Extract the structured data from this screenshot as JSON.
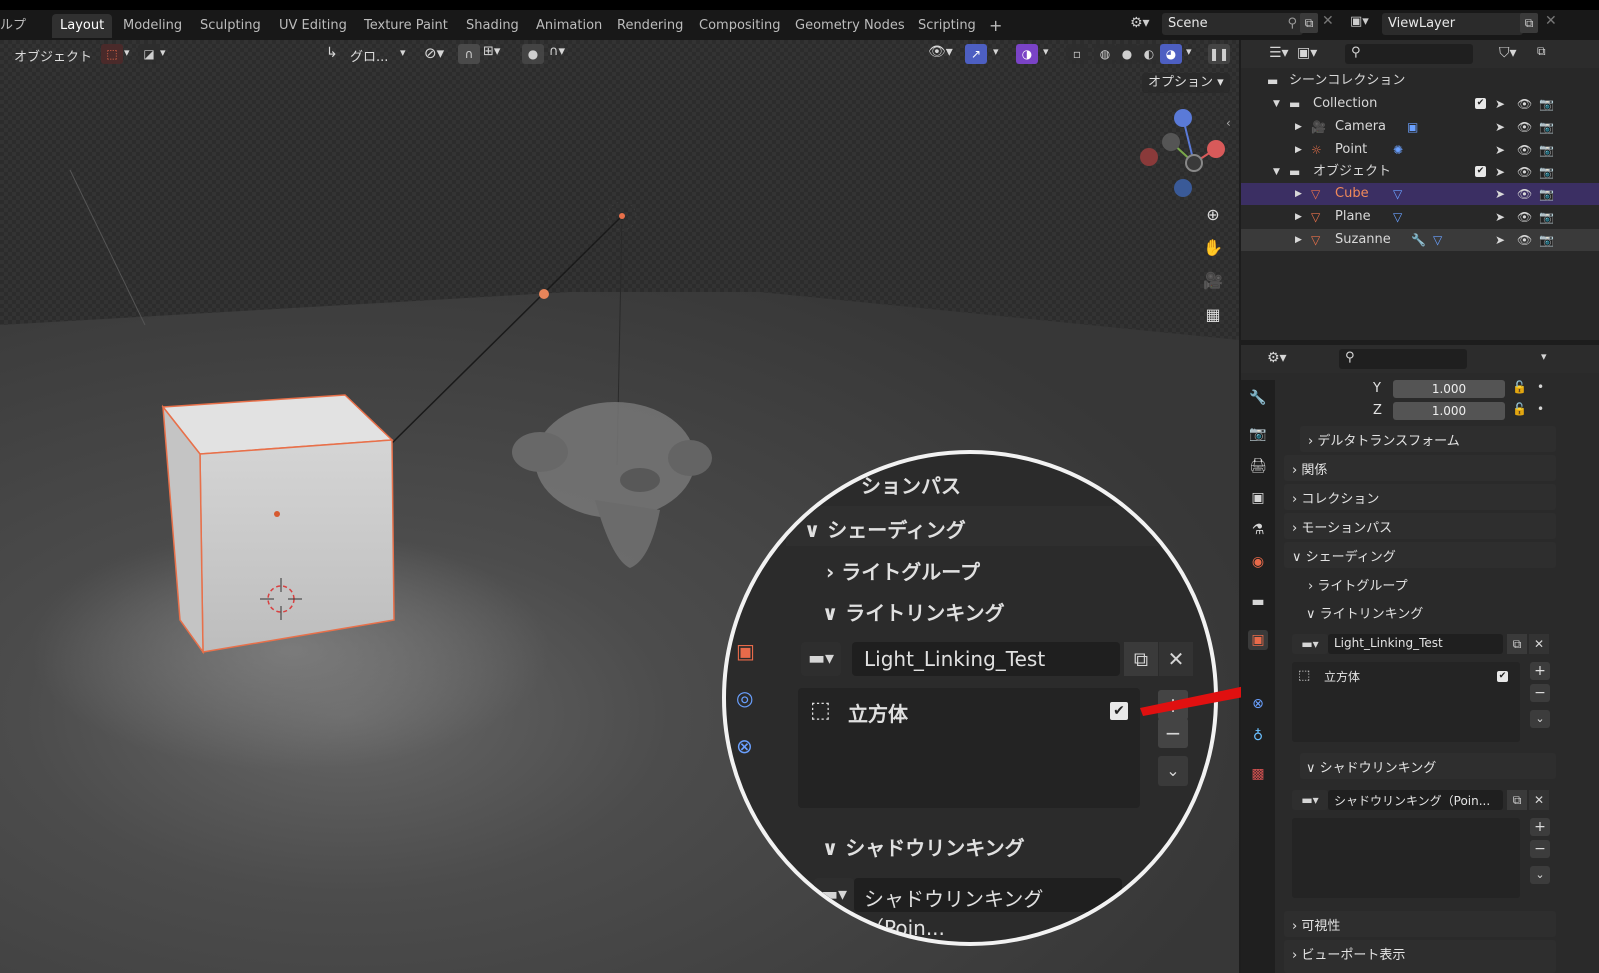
{
  "topbar": {
    "menu_fragment": "ルプ",
    "tabs": [
      "Layout",
      "Modeling",
      "Sculpting",
      "UV Editing",
      "Texture Paint",
      "Shading",
      "Animation",
      "Rendering",
      "Compositing",
      "Geometry Nodes",
      "Scripting"
    ],
    "add_tab": "+",
    "scene": "Scene",
    "view_layer": "ViewLayer"
  },
  "viewport": {
    "mode": "オブジェクト",
    "transform_orientation": "グロ...",
    "options": "オプション"
  },
  "outliner": {
    "scene_collection": "シーンコレクション",
    "rows": [
      {
        "name": "Collection",
        "level": 0
      },
      {
        "name": "Camera",
        "level": 1
      },
      {
        "name": "Point",
        "level": 1
      },
      {
        "name": "オブジェクト",
        "level": 0
      },
      {
        "name": "Cube",
        "level": 1
      },
      {
        "name": "Plane",
        "level": 1
      },
      {
        "name": "Suzanne",
        "level": 1
      }
    ]
  },
  "properties": {
    "scale_y_label": "Y",
    "scale_y": "1.000",
    "scale_z_label": "Z",
    "scale_z": "1.000",
    "delta_transform": "デルタトランスフォーム",
    "relations": "関係",
    "collections": "コレクション",
    "motion_paths": "モーションパス",
    "shading": "シェーディング",
    "light_group": "ライトグループ",
    "light_linking": "ライトリンキング",
    "light_linking_collection": "Light_Linking_Test",
    "light_linking_item": "立方体",
    "shadow_linking": "シャドウリンキング",
    "shadow_linking_collection": "シャドウリンキング（Poin...",
    "visibility": "可視性",
    "viewport_display": "ビューポート表示"
  },
  "magnifier": {
    "motion_paths_fragment": "ションパス",
    "shading": "シェーディング",
    "light_group": "ライトグループ",
    "light_linking": "ライトリンキング",
    "collection": "Light_Linking_Test",
    "item": "立方体",
    "shadow_linking": "シャドウリンキング",
    "shadow_collection": "シャドウリンキング（Poin..."
  },
  "colors": {
    "selection": "#3b2f63",
    "accent_blue": "#4d5fc2",
    "accent_purple": "#7a43c6",
    "object_orange": "#e8704a",
    "arrow_red": "#e01010"
  }
}
